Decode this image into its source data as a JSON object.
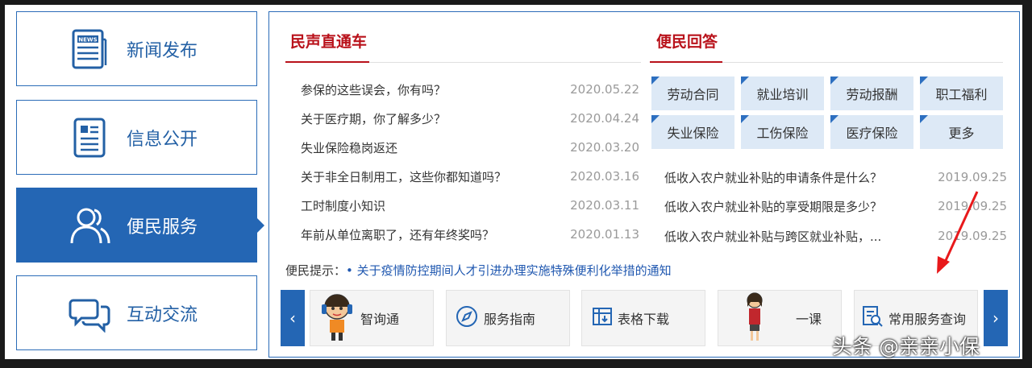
{
  "nav": [
    {
      "label": "新闻发布",
      "icon": "newspaper-icon",
      "active": false
    },
    {
      "label": "信息公开",
      "icon": "document-icon",
      "active": false
    },
    {
      "label": "便民服务",
      "icon": "users-icon",
      "active": true
    },
    {
      "label": "互动交流",
      "icon": "chat-bubbles-icon",
      "active": false
    }
  ],
  "news": {
    "title": "民声直通车",
    "items": [
      {
        "text": "参保的这些误会，你有吗？",
        "date": "2020.05.22"
      },
      {
        "text": "关于医疗期，你了解多少？",
        "date": "2020.04.24"
      },
      {
        "text": "失业保险稳岗返还",
        "date": "2020.03.20"
      },
      {
        "text": "关于非全日制用工，这些你都知道吗？",
        "date": "2020.03.16"
      },
      {
        "text": "工时制度小知识",
        "date": "2020.03.11"
      },
      {
        "text": "年前从单位离职了，还有年终奖吗？",
        "date": "2020.01.13"
      }
    ]
  },
  "qa": {
    "title": "便民回答",
    "tags": [
      "劳动合同",
      "就业培训",
      "劳动报酬",
      "职工福利",
      "失业保险",
      "工伤保险",
      "医疗保险",
      "更多"
    ],
    "items": [
      {
        "text": "低收入农户就业补贴的申请条件是什么？",
        "date": "2019.09.25"
      },
      {
        "text": "低收入农户就业补贴的享受期限是多少？",
        "date": "2019.09.25"
      },
      {
        "text": "低收入农户就业补贴与跨区就业补贴，...",
        "date": "2019.09.25"
      }
    ]
  },
  "tip": {
    "label": "便民提示：",
    "bullet": "•",
    "link": "关于疫情防控期间人才引进办理实施特殊便利化举措的通知"
  },
  "tools": [
    {
      "label": "智询通",
      "icon": "cartoon-headset-icon"
    },
    {
      "label": "服务指南",
      "icon": "compass-icon"
    },
    {
      "label": "表格下载",
      "icon": "table-download-icon"
    },
    {
      "label": "一课",
      "icon": "cartoon-teacher-icon"
    },
    {
      "label": "常用服务查询",
      "icon": "search-document-icon"
    }
  ],
  "carousel": {
    "prev": "‹",
    "next": "›"
  },
  "watermark": "头条 @亲亲小保",
  "colors": {
    "accent": "#2466b4",
    "title_red": "#b9121b",
    "tag_bg": "#dde9f6"
  }
}
